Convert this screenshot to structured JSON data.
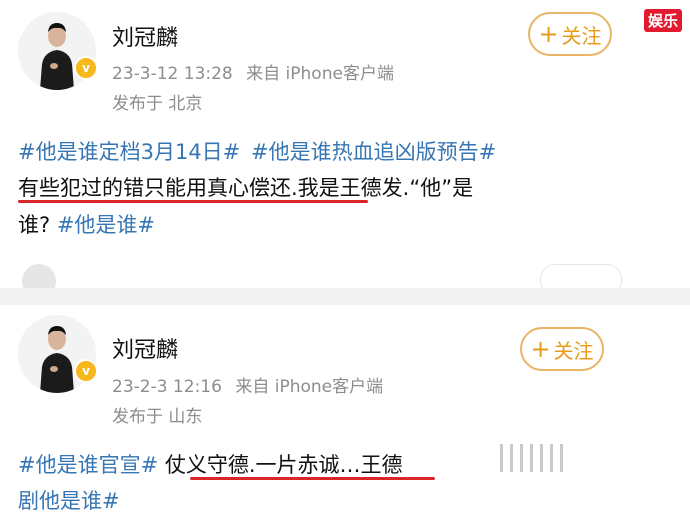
{
  "posts": [
    {
      "author": "刘冠麟",
      "timestamp": "23-3-12 13:28",
      "source": "来自 iPhone客户端",
      "location": "发布于 北京",
      "follow_label": "关注",
      "line1_tag1": "#他是谁定档3月14日#",
      "line1_tag2": "#他是谁热血追凶版预告#",
      "line2_text": "有些犯过的错只能用真心偿还.我是王德发.“他”是",
      "line3_text": "谁? ",
      "line3_tag": "#他是谁#"
    },
    {
      "author": "刘冠麟",
      "timestamp": "23-2-3 12:16",
      "source": "来自 iPhone客户端",
      "location": "发布于 山东",
      "follow_label": "关注",
      "line1_tag": "#他是谁官宣#",
      "line1_text": " 仗义守德.一片赤诚…王德",
      "line2_tag": "剧他是谁#"
    }
  ],
  "watermark": "娱乐",
  "colors": {
    "hashtag": "#3776b5",
    "follow": "#e89b19",
    "underline": "#d9262b",
    "verified": "#f6b81a"
  },
  "icons": {
    "verified_badge": "v-badge",
    "follow_plus": "plus-icon",
    "avatar": "person-photo"
  }
}
